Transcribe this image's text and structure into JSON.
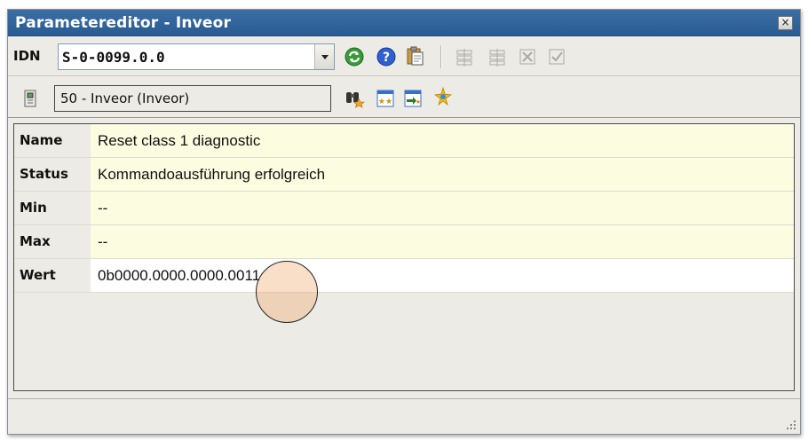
{
  "window": {
    "title": "Parametereditor - Inveor",
    "close_glyph": "×"
  },
  "toolbar1": {
    "idn_label": "IDN",
    "idn_value": "S-0-0099.0.0",
    "icons": [
      "refresh-icon",
      "help-icon",
      "clipboard-icon",
      "tool-disabled-1-icon",
      "tool-disabled-2-icon",
      "tool-disabled-3-icon",
      "tool-disabled-4-icon"
    ]
  },
  "toolbar2": {
    "device": "50 - Inveor (Inveor)",
    "icons": [
      "device-icon",
      "binoculars-star-icon",
      "table-star-icon",
      "import-icon",
      "sparkle-icon"
    ]
  },
  "params": [
    {
      "label": "Name",
      "value": "Reset class 1 diagnostic"
    },
    {
      "label": "Status",
      "value": "Kommandoausführung erfolgreich"
    },
    {
      "label": "Min",
      "value": "--"
    },
    {
      "label": "Max",
      "value": "--"
    },
    {
      "label": "Wert",
      "value": "0b0000.0000.0000.0011"
    }
  ],
  "colors": {
    "titlebar": "#2f62a0",
    "readonly_row": "#fcfce0",
    "editable_row": "#ffffff",
    "highlight": "#f0aa6e"
  }
}
